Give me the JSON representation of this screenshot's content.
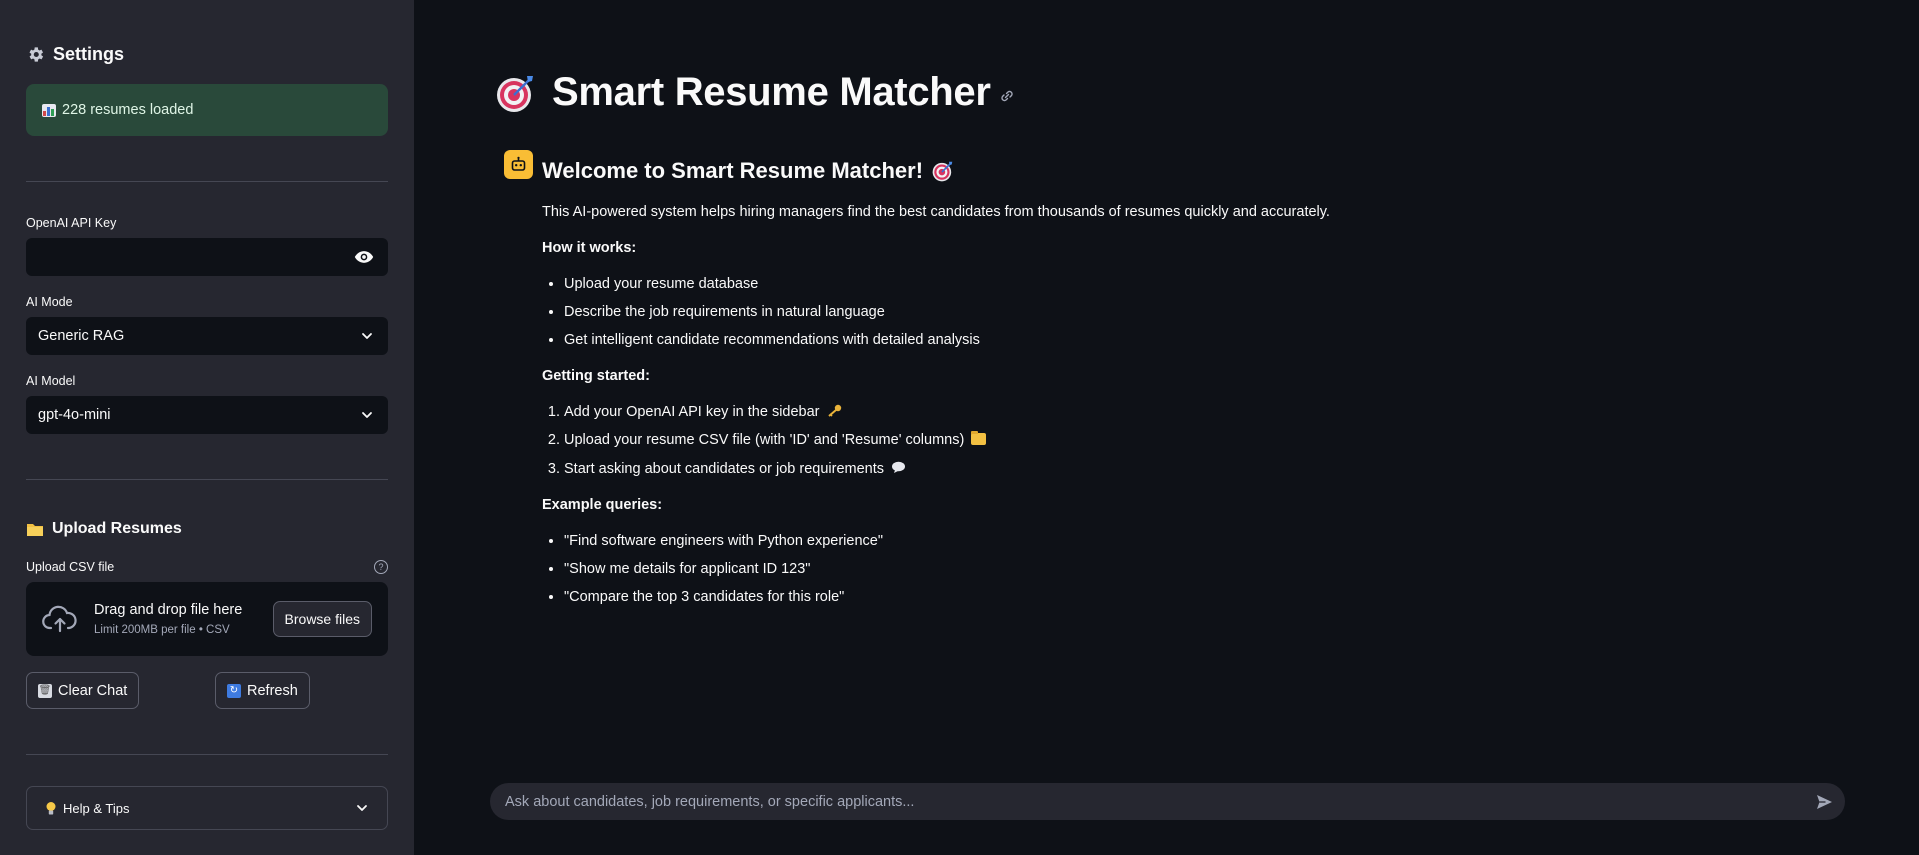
{
  "colors": {
    "sidebar_bg": "#262730",
    "main_bg": "#0e1117",
    "success_bg": "#29493a",
    "avatar_bg": "#f9bd35",
    "text": "#fafafa",
    "muted": "#a3a8b8"
  },
  "sidebar": {
    "settings_title": "Settings",
    "settings_icon": "gear-icon",
    "status_text": "228 resumes loaded",
    "api_key": {
      "label": "OpenAI API Key",
      "value": ""
    },
    "ai_mode": {
      "label": "AI Mode",
      "selected": "Generic RAG"
    },
    "ai_model": {
      "label": "AI Model",
      "selected": "gpt-4o-mini"
    },
    "upload": {
      "title": "Upload Resumes",
      "label": "Upload CSV file",
      "drag_text": "Drag and drop file here",
      "limit_text": "Limit 200MB per file • CSV",
      "browse_label": "Browse files"
    },
    "clear_chat_label": "Clear Chat",
    "refresh_label": "Refresh",
    "help_tips_label": "Help & Tips"
  },
  "main": {
    "title": "Smart Resume Matcher",
    "message": {
      "heading": "Welcome to Smart Resume Matcher!",
      "intro": "This AI-powered system helps hiring managers find the best candidates from thousands of resumes quickly and accurately.",
      "how_title": "How it works:",
      "how_items": [
        "Upload your resume database",
        "Describe the job requirements in natural language",
        "Get intelligent candidate recommendations with detailed analysis"
      ],
      "start_title": "Getting started:",
      "start_items": [
        "Add your OpenAI API key in the sidebar",
        "Upload your resume CSV file (with 'ID' and 'Resume' columns)",
        "Start asking about candidates or job requirements"
      ],
      "examples_title": "Example queries:",
      "examples": [
        "\"Find software engineers with Python experience\"",
        "\"Show me details for applicant ID 123\"",
        "\"Compare the top 3 candidates for this role\""
      ]
    }
  },
  "chat": {
    "placeholder": "Ask about candidates, job requirements, or specific applicants..."
  }
}
